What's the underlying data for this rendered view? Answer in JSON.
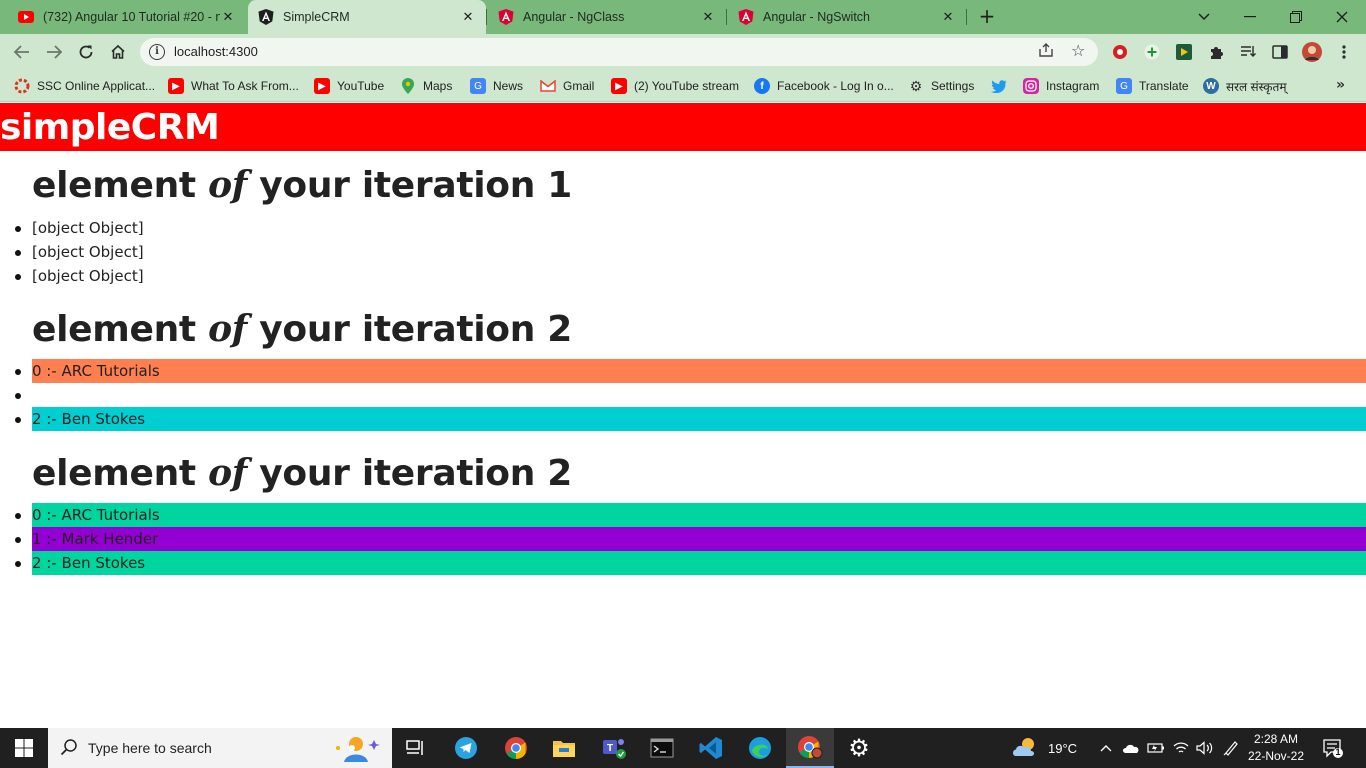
{
  "browser": {
    "tabs": [
      {
        "title": "(732) Angular 10 Tutorial #20 - n",
        "favicon": "youtube-icon",
        "active": false
      },
      {
        "title": "SimpleCRM",
        "favicon": "angular-icon",
        "active": true
      },
      {
        "title": "Angular - NgClass",
        "favicon": "angular-icon",
        "active": false
      },
      {
        "title": "Angular - NgSwitch",
        "favicon": "angular-icon",
        "active": false
      }
    ],
    "url": "localhost:4300",
    "bookmarks": [
      {
        "label": "SSC Online Applicat...",
        "icon": "ssc-icon"
      },
      {
        "label": "What To Ask From...",
        "icon": "youtube-icon"
      },
      {
        "label": "YouTube",
        "icon": "youtube-icon"
      },
      {
        "label": "Maps",
        "icon": "maps-icon"
      },
      {
        "label": "News",
        "icon": "news-icon"
      },
      {
        "label": "Gmail",
        "icon": "gmail-icon"
      },
      {
        "label": "(2) YouTube stream",
        "icon": "youtube-icon"
      },
      {
        "label": "Facebook - Log In o...",
        "icon": "facebook-icon"
      },
      {
        "label": "Settings",
        "icon": "gear-icon"
      },
      {
        "label": "",
        "icon": "twitter-icon"
      },
      {
        "label": "Instagram",
        "icon": "instagram-icon"
      },
      {
        "label": "Translate",
        "icon": "translate-icon"
      },
      {
        "label": "सरल संस्कृतम्",
        "icon": "wordpress-icon"
      }
    ]
  },
  "app": {
    "title": "simpleCRM"
  },
  "sections": [
    {
      "heading_pre": "element ",
      "heading_kw": "of",
      "heading_post": " your iteration 1",
      "items": [
        {
          "text": "[object Object]",
          "bg": ""
        },
        {
          "text": "[object Object]",
          "bg": ""
        },
        {
          "text": "[object Object]",
          "bg": ""
        }
      ]
    },
    {
      "heading_pre": "element ",
      "heading_kw": "of",
      "heading_post": " your iteration 2",
      "items": [
        {
          "text": "0 :- ARC Tutorials",
          "bg": "#ff7f50"
        },
        {
          "text": "",
          "bg": ""
        },
        {
          "text": "2 :- Ben Stokes",
          "bg": "#00ced1"
        }
      ]
    },
    {
      "heading_pre": "element ",
      "heading_kw": "of",
      "heading_post": " your iteration 2",
      "items": [
        {
          "text": "0 :- ARC Tutorials",
          "bg": "#00d5a0"
        },
        {
          "text": "1 :- Mark Hender",
          "bg": "#9400d3"
        },
        {
          "text": "2 :- Ben Stokes",
          "bg": "#00d5a0"
        }
      ]
    }
  ],
  "taskbar": {
    "search_placeholder": "Type here to search",
    "weather": "19°C",
    "time": "2:28 AM",
    "date": "22-Nov-22",
    "notification_count": "1"
  }
}
